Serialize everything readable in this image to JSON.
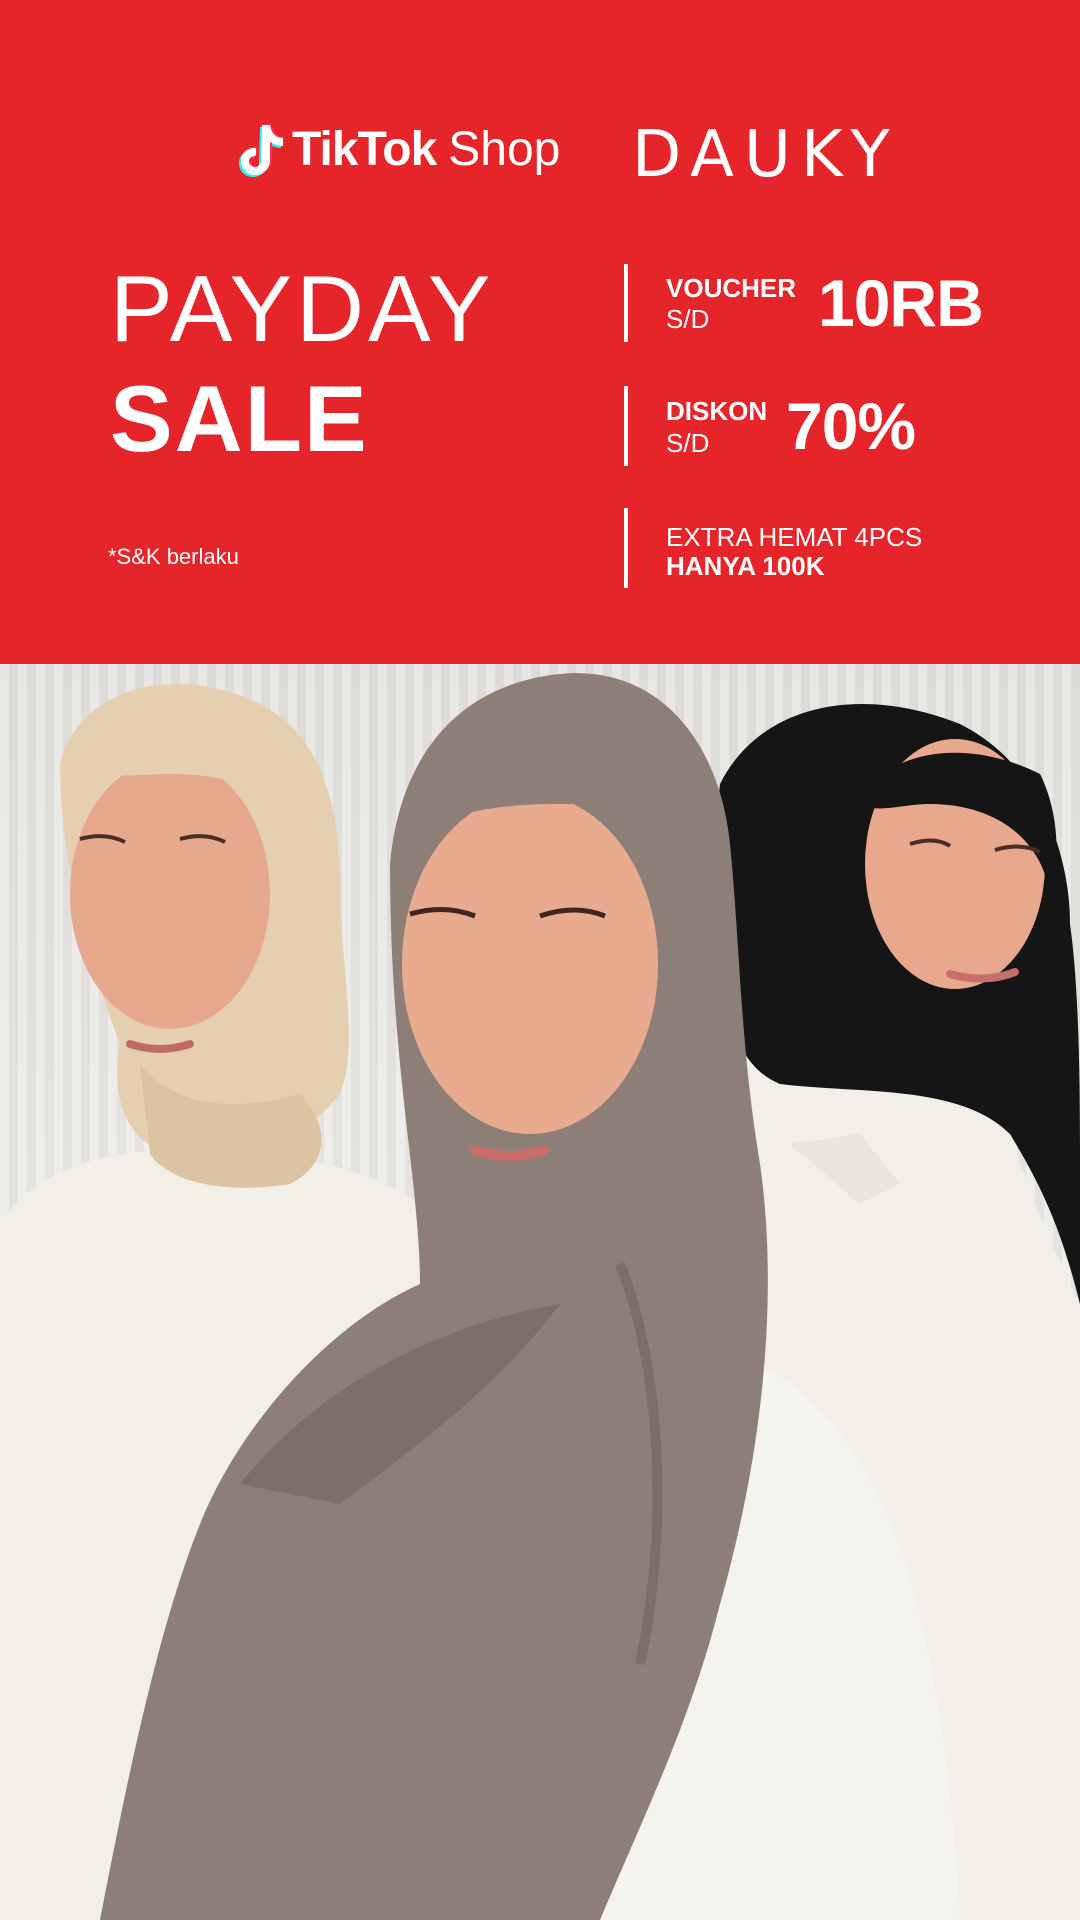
{
  "logos": {
    "platform_brand": "TikTok",
    "platform_suffix": "Shop",
    "store_brand": "DAUKY"
  },
  "headline": {
    "line1": "PAYDAY",
    "line2": "SALE"
  },
  "terms": "*S&K berlaku",
  "offers": [
    {
      "label": "VOUCHER",
      "sub": "S/D",
      "value": "10RB"
    },
    {
      "label": "DISKON",
      "sub": "S/D",
      "value": "70%"
    }
  ],
  "extra": {
    "line1": "EXTRA HEMAT 4PCS",
    "line2": "HANYA 100K"
  },
  "colors": {
    "banner_red": "#e52529",
    "text": "#ffffff",
    "hijab_beige": "#e6cfb0",
    "hijab_taupe": "#8d7f78",
    "hijab_black": "#151515",
    "shirt_white": "#f1efe8"
  },
  "photo": {
    "icon": "three-models-photo"
  }
}
